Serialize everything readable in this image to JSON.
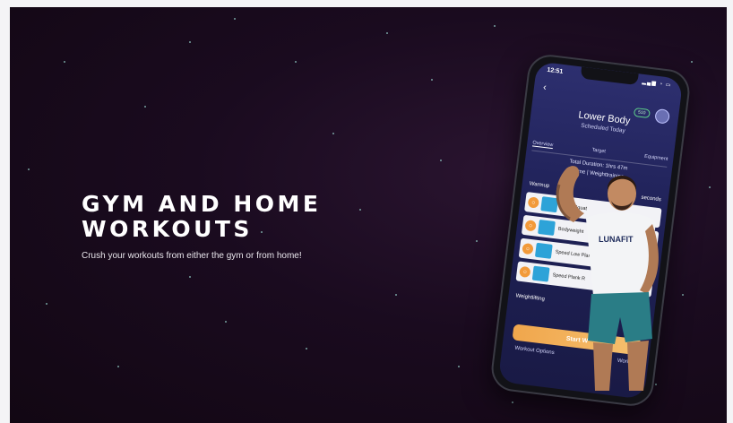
{
  "hero": {
    "title_line1": "GYM AND HOME",
    "title_line2": "WORKOUTS",
    "subtitle": "Crush your workouts from either the gym or from home!"
  },
  "phone": {
    "status_time": "12:51",
    "coins": "510",
    "workout_title": "Lower Body",
    "workout_subtitle": "Scheduled Today",
    "tabs": [
      "Overview",
      "Target",
      "Equipment"
    ],
    "total_duration": "Total Duration: 1hrs 47m",
    "tags": "Home | Weighttraining",
    "warmup_label": "Warmup",
    "warmup_seconds": "seconds",
    "exercises": [
      "Deep Squat",
      "Bodyweight",
      "Speed Low Plank",
      "Speed Plank R"
    ],
    "weightlifting_label": "Weightlifting",
    "start_button": "Start W",
    "workout_options": "Workout Options",
    "workout_more": "Workou"
  },
  "trainer": {
    "shirt_logo": "LUNAFIT"
  }
}
